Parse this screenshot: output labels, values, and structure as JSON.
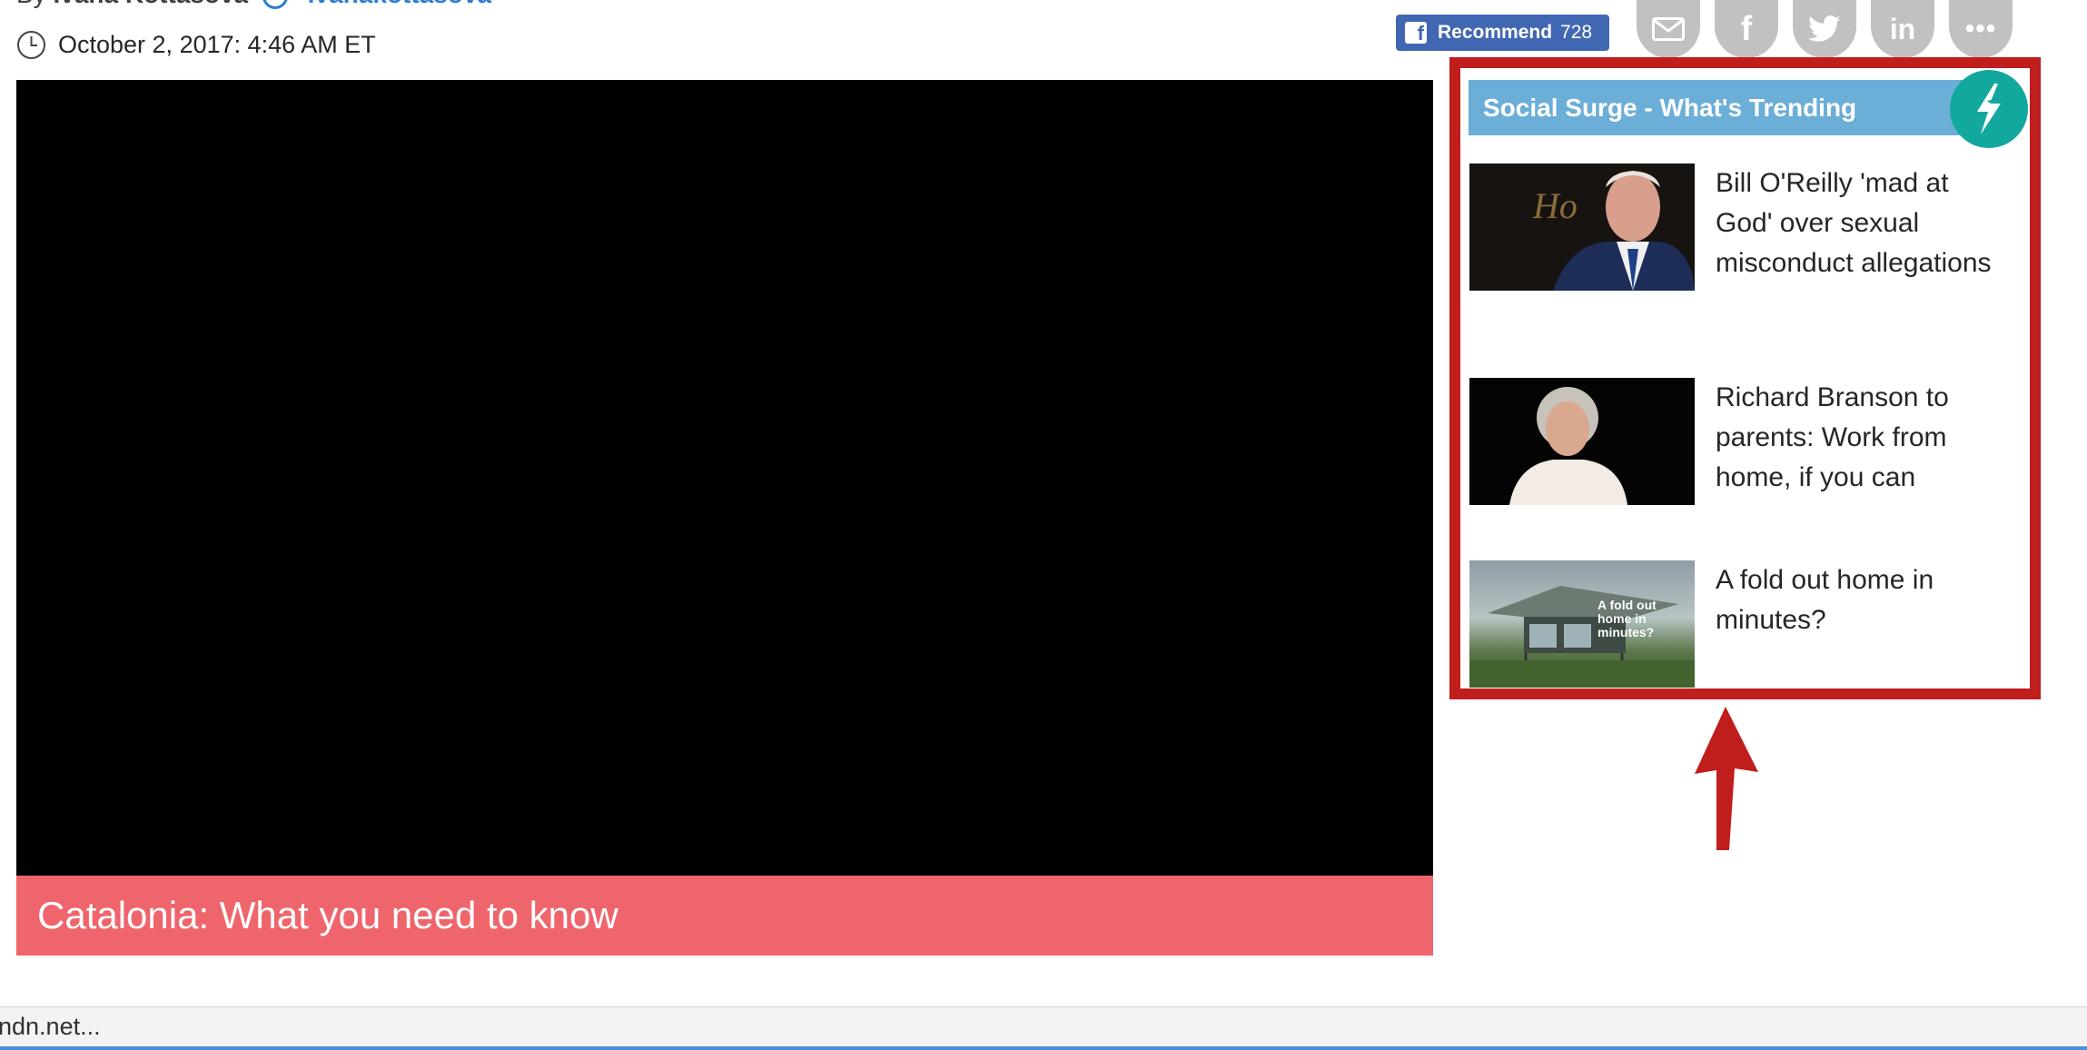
{
  "article": {
    "byline_prefix": "By",
    "author": "Ivana Kottasová",
    "handle": "ivanakottasova",
    "timestamp": "October 2, 2017: 4:46 AM ET"
  },
  "share_bar": {
    "recommend_label": "Recommend",
    "recommend_count": "728",
    "icons": [
      "email-icon",
      "facebook-icon",
      "twitter-icon",
      "linkedin-icon",
      "more-icon"
    ]
  },
  "video": {
    "caption": "Catalonia: What you need to know"
  },
  "social_surge": {
    "header": "Social Surge - What's Trending",
    "items": [
      {
        "title": "Bill O'Reilly 'mad at God' over sexual misconduct allegations"
      },
      {
        "title": "Richard Branson to parents: Work from home, if you can"
      },
      {
        "title": "A fold out home in minutes?",
        "thumb_overlay": "A fold out home in minutes?"
      }
    ]
  },
  "status_bar": {
    "text": "ndn.net..."
  },
  "colors": {
    "caption_bg": "#ef656c",
    "surge_header_bg": "#6baed8",
    "surge_badge_bg": "#13a89e",
    "highlight": "#c01d1d",
    "facebook": "#4267b2"
  }
}
